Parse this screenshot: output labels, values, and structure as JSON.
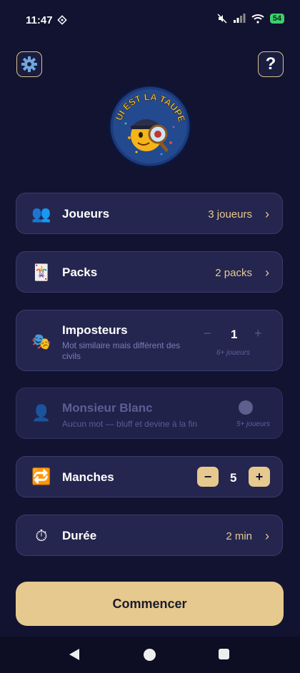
{
  "status": {
    "time": "11:47",
    "battery": "54"
  },
  "cards": {
    "players": {
      "label": "Joueurs",
      "value": "3 joueurs"
    },
    "packs": {
      "label": "Packs",
      "value": "2 packs"
    },
    "impostors": {
      "label": "Imposteurs",
      "description": "Mot similaire mais différent des civils",
      "value": "1",
      "note": "6+ joueurs"
    },
    "mr_white": {
      "label": "Monsieur Blanc",
      "description": "Aucun mot — bluff et devine à la fin",
      "note": "5+ joueurs",
      "enabled": false
    },
    "rounds": {
      "label": "Manches",
      "value": "5"
    },
    "duration": {
      "label": "Durée",
      "value": "2 min"
    }
  },
  "start_label": "Commencer",
  "colors": {
    "background": "#121330",
    "card": "#25264f",
    "accent": "#e6c98e"
  }
}
